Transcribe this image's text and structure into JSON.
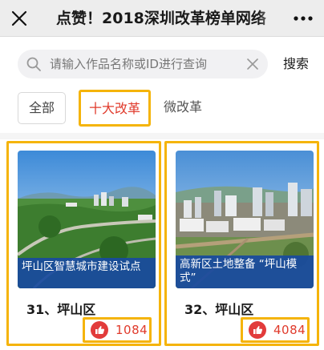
{
  "header": {
    "title": "点赞！2018深圳改革榜单网络",
    "close_icon": "close-icon",
    "more_icon": "more-dots-icon"
  },
  "search": {
    "placeholder": "请输入作品名称或ID进行查询",
    "value": "",
    "button_label": "搜索"
  },
  "tabs": [
    {
      "label": "全部",
      "active": false
    },
    {
      "label": "十大改革",
      "active": true
    },
    {
      "label": "微改革",
      "active": false
    }
  ],
  "cards": [
    {
      "caption": "坪山区智慧城市建设试点",
      "title": "31、坪山区",
      "likes": "1084"
    },
    {
      "caption": "高新区土地整备 “坪山模式”",
      "title": "32、坪山区",
      "likes": "4084"
    }
  ],
  "colors": {
    "accent_red": "#e03a2b",
    "highlight_yellow": "#f5b40a",
    "caption_blue": "#184aa0"
  }
}
